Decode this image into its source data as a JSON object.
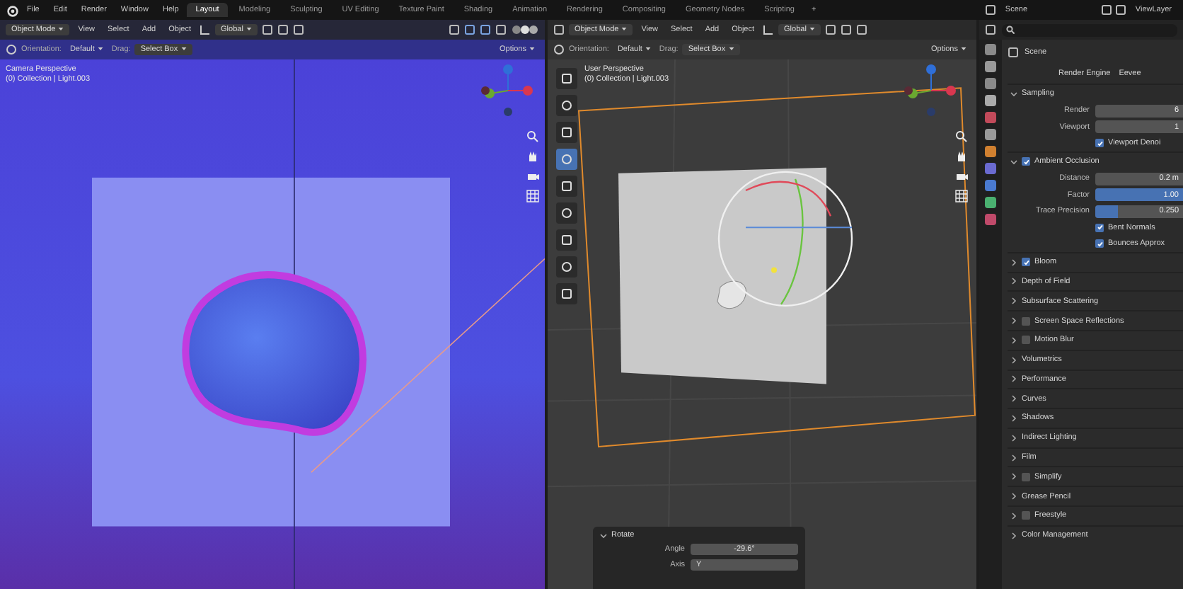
{
  "menu": [
    "File",
    "Edit",
    "Render",
    "Window",
    "Help"
  ],
  "workspaces": [
    {
      "label": "Layout",
      "selected": true
    },
    {
      "label": "Modeling",
      "selected": false
    },
    {
      "label": "Sculpting",
      "selected": false
    },
    {
      "label": "UV Editing",
      "selected": false
    },
    {
      "label": "Texture Paint",
      "selected": false
    },
    {
      "label": "Shading",
      "selected": false
    },
    {
      "label": "Animation",
      "selected": false
    },
    {
      "label": "Rendering",
      "selected": false
    },
    {
      "label": "Compositing",
      "selected": false
    },
    {
      "label": "Geometry Nodes",
      "selected": false
    },
    {
      "label": "Scripting",
      "selected": false
    }
  ],
  "add_workspace": "+",
  "scene": "Scene",
  "view_layer": "ViewLayer",
  "viewports": [
    {
      "kind": "camera",
      "menus": [
        "Object Mode",
        "View",
        "Select",
        "Add",
        "Object"
      ],
      "transform": "Global",
      "orientation_label": "Orientation:",
      "orientation": "Default",
      "drag_label": "Drag:",
      "drag": "Select Box",
      "options": "Options",
      "overlay": [
        "Camera Perspective",
        "(0) Collection | Light.003"
      ]
    },
    {
      "kind": "user",
      "menus": [
        "Object Mode",
        "View",
        "Select",
        "Add",
        "Object"
      ],
      "transform": "Global",
      "orientation_label": "Orientation:",
      "orientation": "Default",
      "drag_label": "Drag:",
      "drag": "Select Box",
      "options": "Options",
      "overlay": [
        "User Perspective",
        "(0) Collection | Light.003"
      ]
    }
  ],
  "tools": [
    {
      "selected": false
    },
    {
      "selected": false
    },
    {
      "selected": false
    },
    {
      "selected": true
    },
    {
      "selected": false
    },
    {
      "selected": false
    },
    {
      "selected": false
    },
    {
      "selected": false
    },
    {
      "selected": false
    }
  ],
  "redo_panel": {
    "title": "Rotate",
    "expanded": true,
    "fields": [
      {
        "label": "Angle",
        "value": "-29.6°"
      },
      {
        "label": "Axis",
        "value": "Y"
      }
    ]
  },
  "properties": {
    "context": "Scene",
    "render_engine_label": "Render Engine",
    "render_engine": "Eevee",
    "rows": [
      {
        "kind": "panel",
        "label": "Sampling",
        "expanded": true
      },
      {
        "kind": "field",
        "label": "Render",
        "value": "6"
      },
      {
        "kind": "field",
        "label": "Viewport",
        "value": "1"
      },
      {
        "kind": "check",
        "label": "Viewport Denoi",
        "checked": true
      },
      {
        "kind": "toggle",
        "label": "Ambient Occlusion",
        "expanded": true,
        "checked": true
      },
      {
        "kind": "field",
        "label": "Distance",
        "value": "0.2 m"
      },
      {
        "kind": "slider",
        "label": "Factor",
        "value": "1.00",
        "level": 1
      },
      {
        "kind": "slider",
        "label": "Trace Precision",
        "value": "0.250",
        "level": 0.25
      },
      {
        "kind": "check",
        "label": "Bent Normals",
        "checked": true
      },
      {
        "kind": "check",
        "label": "Bounces Approx",
        "checked": true
      },
      {
        "kind": "toggle",
        "label": "Bloom",
        "expanded": false,
        "checked": true
      },
      {
        "kind": "panel",
        "label": "Depth of Field",
        "expanded": false
      },
      {
        "kind": "panel",
        "label": "Subsurface Scattering",
        "expanded": false
      },
      {
        "kind": "toggle",
        "label": "Screen Space Reflections",
        "expanded": false,
        "checked": false
      },
      {
        "kind": "toggle",
        "label": "Motion Blur",
        "expanded": false,
        "checked": false
      },
      {
        "kind": "panel",
        "label": "Volumetrics",
        "expanded": false
      },
      {
        "kind": "panel",
        "label": "Performance",
        "expanded": false
      },
      {
        "kind": "panel",
        "label": "Curves",
        "expanded": false
      },
      {
        "kind": "panel",
        "label": "Shadows",
        "expanded": false
      },
      {
        "kind": "panel",
        "label": "Indirect Lighting",
        "expanded": false
      },
      {
        "kind": "panel",
        "label": "Film",
        "expanded": false
      },
      {
        "kind": "toggle",
        "label": "Simplify",
        "expanded": false,
        "checked": false
      },
      {
        "kind": "panel",
        "label": "Grease Pencil",
        "expanded": false
      },
      {
        "kind": "toggle",
        "label": "Freestyle",
        "expanded": false,
        "checked": false
      },
      {
        "kind": "panel",
        "label": "Color Management",
        "expanded": false
      }
    ]
  }
}
